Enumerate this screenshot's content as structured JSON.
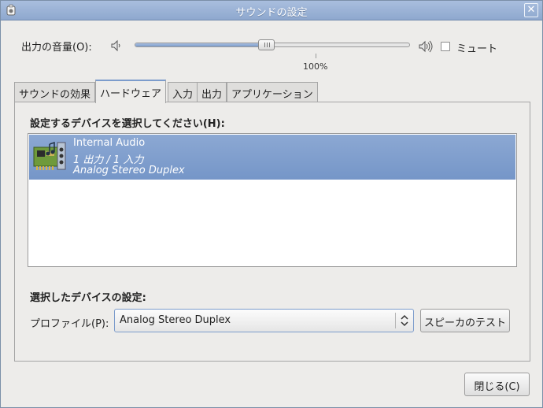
{
  "window": {
    "title": "サウンドの設定"
  },
  "volume": {
    "label": "出力の音量(O):",
    "percent_label": "100%",
    "level_percent": 48,
    "mute_label": "ミュート",
    "mute_checked": false
  },
  "tabs": [
    {
      "label": "サウンドの効果",
      "active": false
    },
    {
      "label": "ハードウェア",
      "active": true
    },
    {
      "label": "入力",
      "active": false
    },
    {
      "label": "出力",
      "active": false
    },
    {
      "label": "アプリケーション",
      "active": false
    }
  ],
  "hardware": {
    "select_device_label": "設定するデバイスを選択してください(H):",
    "devices": [
      {
        "name": "Internal Audio",
        "io": "1 出力 / 1 入力",
        "profile": "Analog Stereo Duplex",
        "selected": true
      }
    ],
    "settings_label": "選択したデバイスの設定:",
    "profile_label": "プロファイル(P):",
    "profile_value": "Analog Stereo Duplex",
    "test_button": "スピーカのテスト"
  },
  "footer": {
    "close_button": "閉じる(C)"
  },
  "colors": {
    "accent": "#7c9ccc",
    "selection": "#7f9dcb",
    "titlebar": "#9bb2d6"
  },
  "icons": {
    "app": "sound-app-icon",
    "close": "close-icon",
    "speaker_low": "speaker-low-icon",
    "speaker_high": "speaker-high-icon",
    "device": "sound-card-icon",
    "select_arrows": "updown-arrows-icon"
  }
}
